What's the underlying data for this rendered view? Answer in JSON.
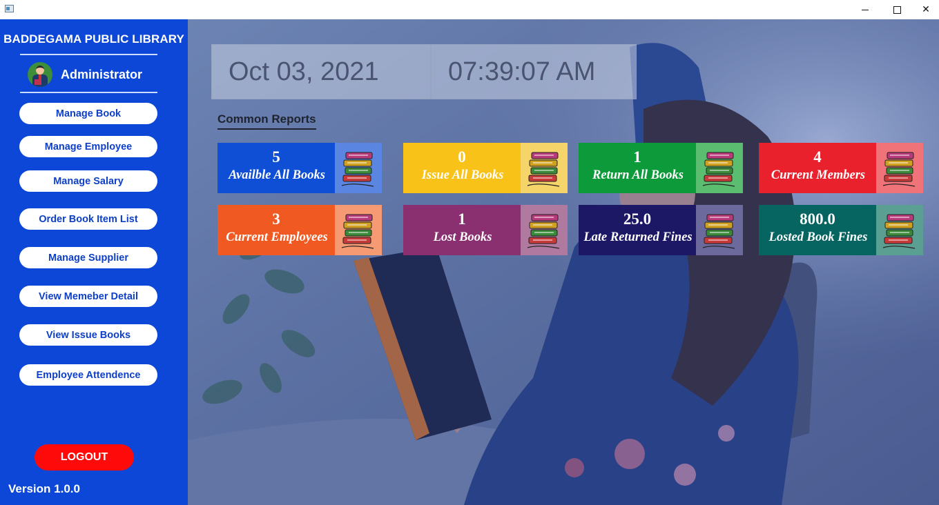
{
  "window": {
    "controls": {
      "minimize_icon": "minimize-icon",
      "maximize_icon": "maximize-icon",
      "close_icon": "close-icon",
      "close_glyph": "✕"
    }
  },
  "sidebar": {
    "library_name": "BADDEGAMA PUBLIC LIBRARY",
    "user_role": "Administrator",
    "menu": [
      {
        "label": "Manage Book"
      },
      {
        "label": "Manage Employee"
      },
      {
        "label": "Manage Salary"
      },
      {
        "label": "Order Book Item List"
      },
      {
        "label": "Manage Supplier"
      },
      {
        "label": "View Memeber Detail"
      },
      {
        "label": "View Issue Books"
      },
      {
        "label": "Employee Attendence"
      }
    ],
    "logout_label": "LOGOUT",
    "version": "Version 1.0.0"
  },
  "main": {
    "date": "Oct 03, 2021",
    "time": "07:39:07 AM",
    "reports_title": "Common Reports",
    "cards": [
      {
        "value": "5",
        "label": "Availble All Books",
        "color": "#0e4fd6",
        "icon_bg": "#5a85e0",
        "icon": "books-icon"
      },
      {
        "value": "0",
        "label": "Issue All Books",
        "color": "#f8c218",
        "icon_bg": "#f5d46a",
        "icon": "books-icon"
      },
      {
        "value": "1",
        "label": "Return All Books",
        "color": "#0d9a3a",
        "icon_bg": "#5bbd6f",
        "icon": "books-icon"
      },
      {
        "value": "4",
        "label": "Current Members",
        "color": "#e8212c",
        "icon_bg": "#ef7379",
        "icon": "books-icon"
      },
      {
        "value": "3",
        "label": "Current Employees",
        "color": "#f05a22",
        "icon_bg": "#f59a72",
        "icon": "books-icon"
      },
      {
        "value": "1",
        "label": "Lost Books",
        "color": "#8a2f6f",
        "icon_bg": "#b07aa0",
        "icon": "books-icon"
      },
      {
        "value": "25.0",
        "label": "Late Returned Fines",
        "color": "#1c1866",
        "icon_bg": "#6c6a9c",
        "icon": "books-icon"
      },
      {
        "value": "800.0",
        "label": "Losted Book Fines",
        "color": "#066461",
        "icon_bg": "#5b9f92",
        "icon": "books-icon"
      }
    ]
  }
}
